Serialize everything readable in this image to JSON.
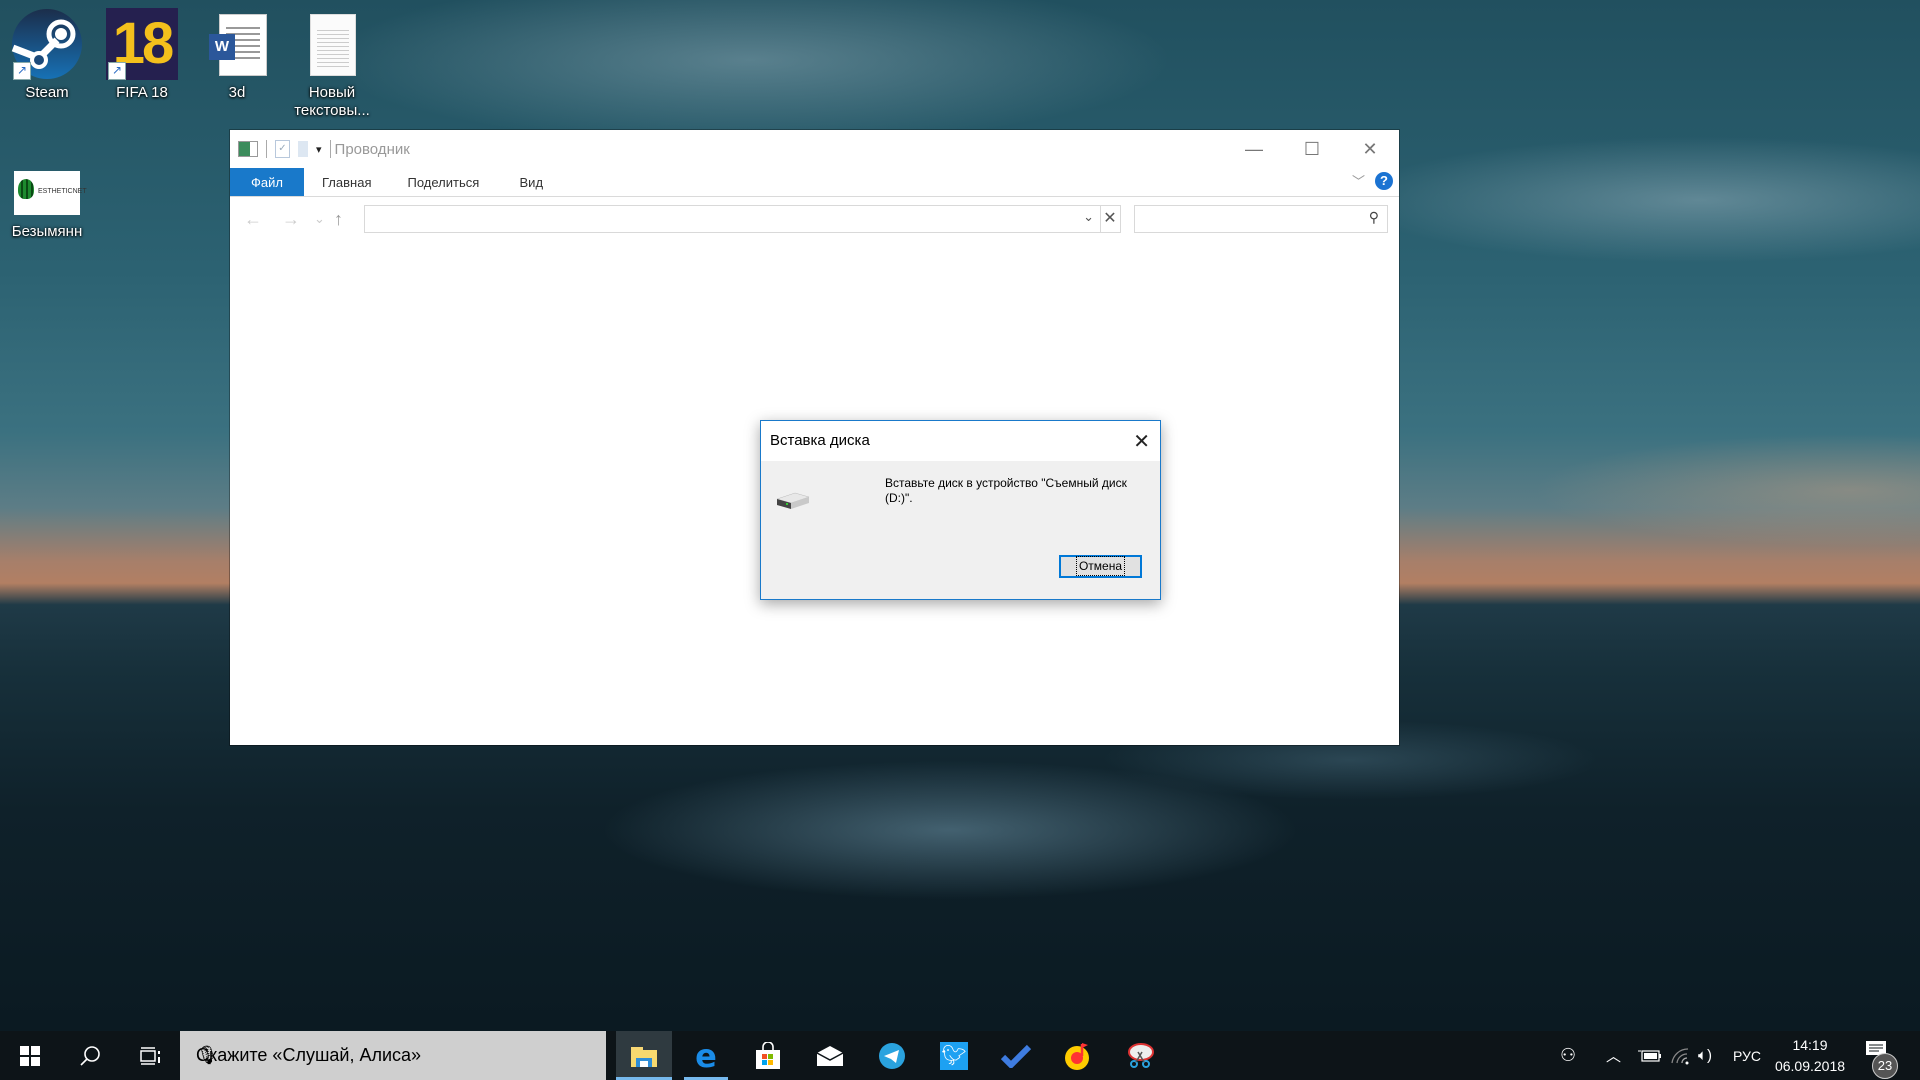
{
  "desktop": {
    "icons": [
      {
        "label": "Steam",
        "icon": "steam-icon",
        "shortcut": true
      },
      {
        "label": "FIFA 18",
        "icon": "fifa18-icon",
        "shortcut": true,
        "glyph": "18"
      },
      {
        "label": "3d",
        "icon": "word-document-icon",
        "shortcut": false,
        "glyph": "W"
      },
      {
        "label": "Новый текстовы...",
        "icon": "text-document-icon",
        "shortcut": false
      },
      {
        "label": "Безымянн",
        "icon": "image-file-icon",
        "shortcut": false,
        "logo_text": "ESTHETICNET"
      }
    ]
  },
  "explorer": {
    "title": "Проводник",
    "tabs": [
      {
        "label": "Файл",
        "active": true
      },
      {
        "label": "Главная"
      },
      {
        "label": "Поделиться"
      },
      {
        "label": "Вид"
      }
    ],
    "help_label": "?",
    "address_value": "",
    "search_placeholder": "",
    "window_buttons": {
      "minimize": "—",
      "maximize": "☐",
      "close": "✕"
    },
    "nav": {
      "back": "←",
      "forward": "→",
      "recent": "⌄",
      "up": "↑"
    }
  },
  "dialog": {
    "title": "Вставка диска",
    "message": "Вставьте диск в устройство \"Съемный диск (D:)\".",
    "cancel_label": "Отмена",
    "close_glyph": "✕"
  },
  "taskbar": {
    "search_placeholder": "Скажите «Слушай, Алиса»",
    "apps": [
      {
        "name": "File Explorer",
        "icon": "file-explorer-icon",
        "state": "active"
      },
      {
        "name": "Microsoft Edge",
        "icon": "edge-icon",
        "state": "running"
      },
      {
        "name": "Microsoft Store",
        "icon": "store-icon",
        "state": "pinned"
      },
      {
        "name": "Mail",
        "icon": "mail-icon",
        "state": "pinned"
      },
      {
        "name": "Telegram",
        "icon": "telegram-icon",
        "state": "pinned"
      },
      {
        "name": "Twitter",
        "icon": "twitter-icon",
        "state": "pinned"
      },
      {
        "name": "Microsoft To-Do",
        "icon": "todo-icon",
        "state": "pinned"
      },
      {
        "name": "Yandex Music",
        "icon": "yandex-music-icon",
        "state": "pinned"
      },
      {
        "name": "Snipping Tool",
        "icon": "snipping-tool-icon",
        "state": "pinned"
      }
    ],
    "tray": {
      "language": "РУС",
      "time": "14:19",
      "date": "06.09.2018",
      "notification_count": "23"
    }
  },
  "colors": {
    "accent": "#1979ca",
    "taskbar": "#0d1418",
    "dialog_bg": "#f0f0f0"
  }
}
